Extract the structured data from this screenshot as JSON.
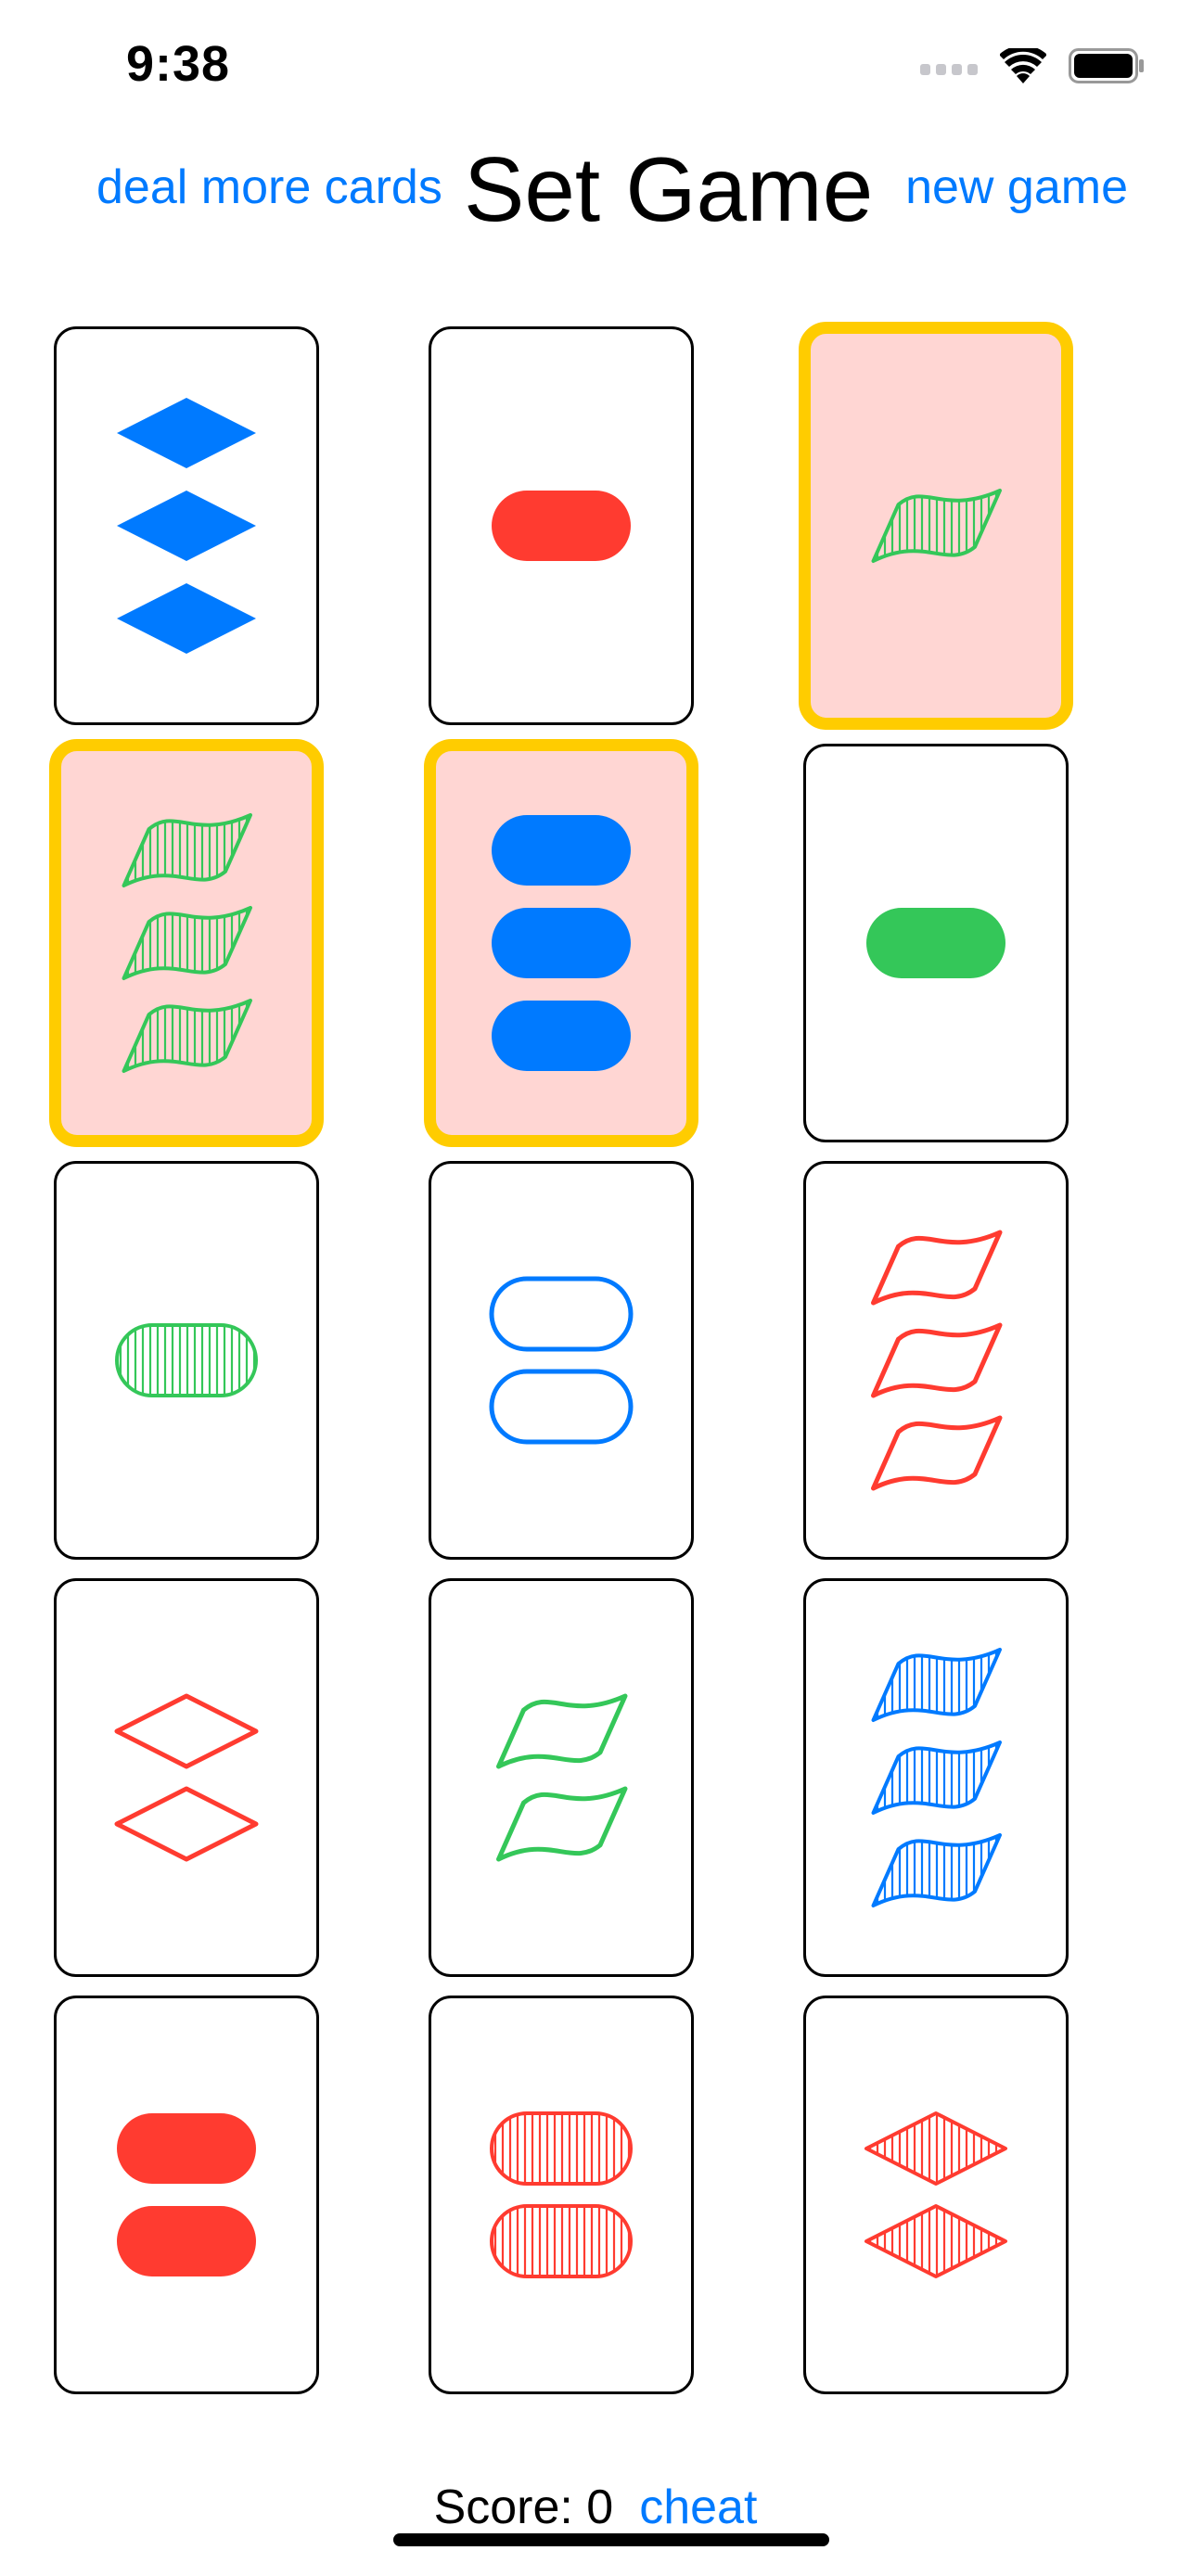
{
  "status_bar": {
    "time": "9:38",
    "icons": [
      "cellular-signal-icon",
      "wifi-icon",
      "battery-icon"
    ]
  },
  "header": {
    "deal_label": "deal more cards",
    "title": "Set Game",
    "new_game_label": "new game"
  },
  "colors": {
    "blue": "#007aff",
    "red": "#ff3b30",
    "green": "#34c759",
    "selected_border": "#ffcc00",
    "selected_background": "#ffd6d3"
  },
  "cards": [
    {
      "count": 3,
      "shape": "diamond",
      "shading": "solid",
      "color": "blue",
      "selected": false
    },
    {
      "count": 1,
      "shape": "oval",
      "shading": "solid",
      "color": "red",
      "selected": false
    },
    {
      "count": 1,
      "shape": "squiggle",
      "shading": "striped",
      "color": "green",
      "selected": true
    },
    {
      "count": 3,
      "shape": "squiggle",
      "shading": "striped",
      "color": "green",
      "selected": true
    },
    {
      "count": 3,
      "shape": "oval",
      "shading": "solid",
      "color": "blue",
      "selected": true
    },
    {
      "count": 1,
      "shape": "oval",
      "shading": "solid",
      "color": "green",
      "selected": false
    },
    {
      "count": 1,
      "shape": "oval",
      "shading": "striped",
      "color": "green",
      "selected": false
    },
    {
      "count": 2,
      "shape": "oval",
      "shading": "open",
      "color": "blue",
      "selected": false
    },
    {
      "count": 3,
      "shape": "squiggle",
      "shading": "open",
      "color": "red",
      "selected": false
    },
    {
      "count": 2,
      "shape": "diamond",
      "shading": "open",
      "color": "red",
      "selected": false
    },
    {
      "count": 2,
      "shape": "squiggle",
      "shading": "open",
      "color": "green",
      "selected": false
    },
    {
      "count": 3,
      "shape": "squiggle",
      "shading": "striped",
      "color": "blue",
      "selected": false
    },
    {
      "count": 2,
      "shape": "oval",
      "shading": "solid",
      "color": "red",
      "selected": false
    },
    {
      "count": 2,
      "shape": "oval",
      "shading": "striped",
      "color": "red",
      "selected": false
    },
    {
      "count": 2,
      "shape": "diamond",
      "shading": "striped",
      "color": "red",
      "selected": false
    }
  ],
  "footer": {
    "score_label": "Score: 0",
    "cheat_label": "cheat"
  }
}
